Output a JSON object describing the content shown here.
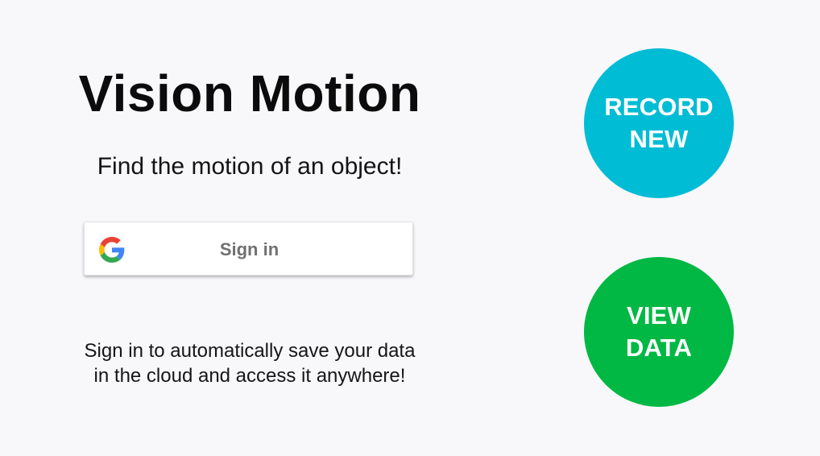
{
  "app": {
    "title": "Vision Motion",
    "subtitle": "Find the motion of an object!"
  },
  "signin": {
    "label": "Sign in",
    "icon": "google-g-icon",
    "hint_line_1": "Sign in to automatically save your data",
    "hint_line_2": "in the cloud and access it anywhere!"
  },
  "actions": {
    "record_new": {
      "line_1": "RECORD",
      "line_2": "NEW",
      "color": "#00bcd4"
    },
    "view_data": {
      "line_1": "VIEW",
      "line_2": "DATA",
      "color": "#00b843"
    }
  },
  "colors": {
    "background": "#f8f7fa",
    "signin_text": "#707070",
    "google_blue": "#4285f4",
    "google_red": "#ea4335",
    "google_yellow": "#fbbc05",
    "google_green": "#34a853"
  }
}
